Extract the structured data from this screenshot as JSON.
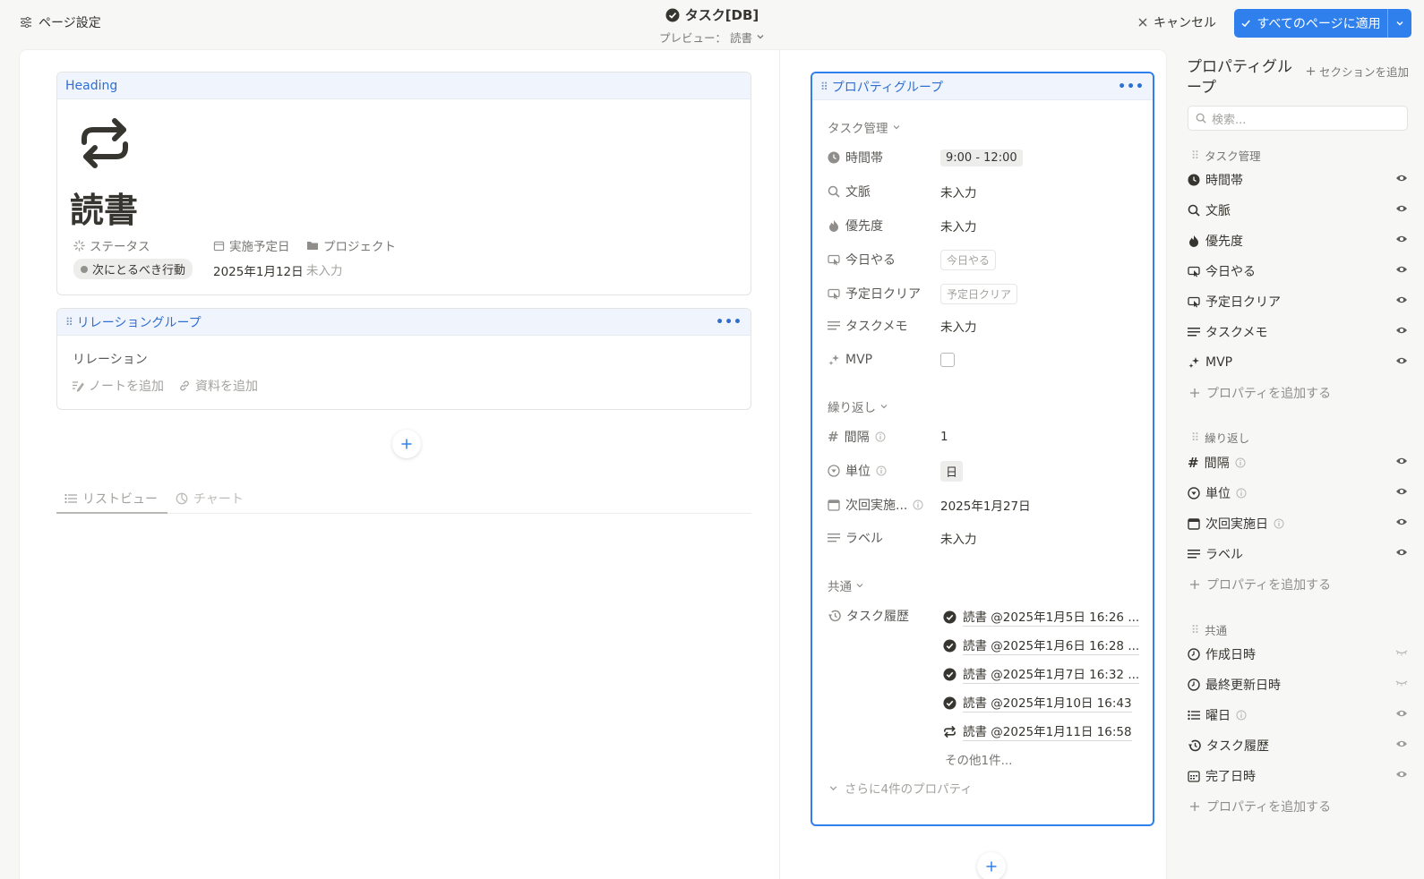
{
  "topbar": {
    "page_settings": "ページ設定",
    "title": "タスク[DB]",
    "preview_label": "プレビュー：",
    "preview_value": "読書",
    "cancel": "キャンセル",
    "apply": "すべてのページに適用"
  },
  "heading_card": {
    "header": "Heading",
    "page_title": "読書",
    "props": [
      {
        "label": "ステータス",
        "value": "次にとるべき行動"
      },
      {
        "label": "実施予定日",
        "value": "2025年1月12日"
      },
      {
        "label": "プロジェクト",
        "value": "未入力"
      }
    ]
  },
  "relation_card": {
    "header": "リレーショングループ",
    "relation_label": "リレーション",
    "add_note": "ノートを追加",
    "add_material": "資料を追加"
  },
  "view_tabs": {
    "list": "リストビュー",
    "chart": "チャート"
  },
  "property_group": {
    "header": "プロパティグループ",
    "sections": {
      "task": "タスク管理",
      "repeat": "繰り返し",
      "common": "共通"
    },
    "rows": {
      "time": {
        "label": "時間帯",
        "value": "9:00 - 12:00"
      },
      "context": {
        "label": "文脈",
        "value": "未入力"
      },
      "priority": {
        "label": "優先度",
        "value": "未入力"
      },
      "today": {
        "label": "今日やる",
        "value": "今日やる"
      },
      "clear": {
        "label": "予定日クリア",
        "value": "予定日クリア"
      },
      "memo": {
        "label": "タスクメモ",
        "value": "未入力"
      },
      "mvp": {
        "label": "MVP"
      },
      "interval": {
        "label": "間隔",
        "value": "1"
      },
      "unit": {
        "label": "単位",
        "value": "日"
      },
      "next": {
        "label": "次回実施...",
        "value": "2025年1月27日"
      },
      "label": {
        "label": "ラベル",
        "value": "未入力"
      },
      "history": {
        "label": "タスク履歴"
      }
    },
    "history": [
      "読書 @2025年1月5日 16:26 ...",
      "読書 @2025年1月6日 16:28 ...",
      "読書 @2025年1月7日 16:32 ...",
      "読書 @2025年1月10日 16:43",
      "読書 @2025年1月11日 16:58"
    ],
    "history_more": "その他1件...",
    "more_props": "さらに4件のプロパティ"
  },
  "sidebar": {
    "title": "プロパティグループ",
    "add_section": "セクションを追加",
    "search_placeholder": "検索...",
    "sections": {
      "task": "タスク管理",
      "repeat": "繰り返し",
      "common": "共通"
    },
    "task_items": [
      "時間帯",
      "文脈",
      "優先度",
      "今日やる",
      "予定日クリア",
      "タスクメモ",
      "MVP"
    ],
    "repeat_items": [
      "間隔",
      "単位",
      "次回実施日",
      "ラベル"
    ],
    "common_items": [
      "作成日時",
      "最終更新日時",
      "曜日",
      "タスク履歴",
      "完了日時"
    ],
    "add_property": "プロパティを追加する"
  }
}
